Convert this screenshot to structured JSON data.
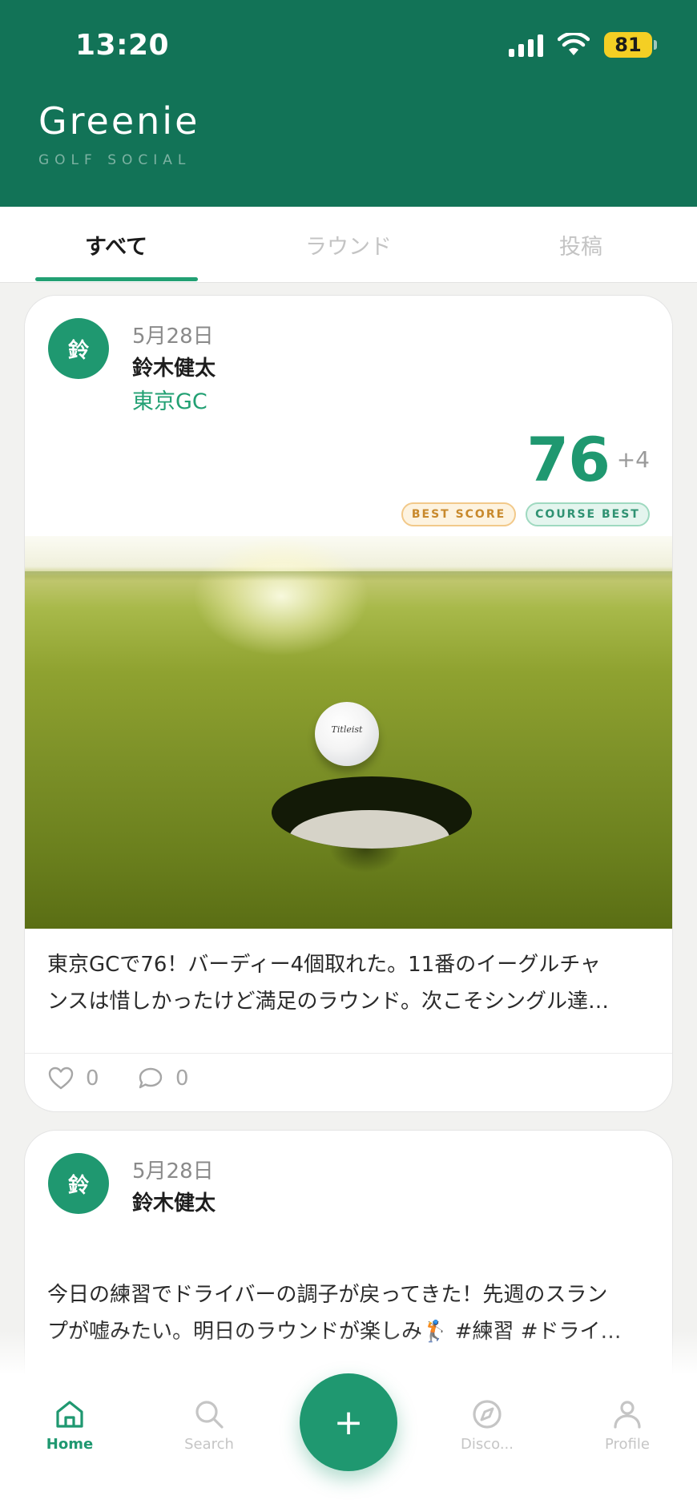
{
  "status_bar": {
    "time": "13:20",
    "battery": "81",
    "icons": [
      "signal-icon",
      "wifi-icon",
      "battery-icon"
    ]
  },
  "header": {
    "title": "Greenie",
    "subtitle": "GOLF SOCIAL"
  },
  "tabs": [
    {
      "label": "すべて",
      "active": true
    },
    {
      "label": "ラウンド",
      "active": false
    },
    {
      "label": "投稿",
      "active": false
    }
  ],
  "feed": [
    {
      "avatar_initial": "鈴",
      "date": "5月28日",
      "author": "鈴木健太",
      "course": "東京GC",
      "score": "76",
      "score_diff": "+4",
      "badges": [
        "BEST SCORE",
        "COURSE BEST"
      ],
      "photo_ball_text": "Titleist",
      "text_lines": [
        "東京GCで76！バーディー4個取れた。11番のイーグルチャ",
        "ンスは惜しかったけど満足のラウンド。次こそシングル達…"
      ],
      "likes": "0",
      "comments": "0"
    },
    {
      "avatar_initial": "鈴",
      "date": "5月28日",
      "author": "鈴木健太",
      "text_lines": [
        "今日の練習でドライバーの調子が戻ってきた！先週のスラン",
        "プが嘘みたい。明日のラウンドが楽しみ🏌 #練習 #ドライ…"
      ]
    }
  ],
  "bottom_nav": {
    "items": [
      {
        "label": "Home",
        "icon": "home-icon",
        "active": true
      },
      {
        "label": "Search",
        "icon": "search-icon",
        "active": false
      },
      {
        "label": "Disco...",
        "icon": "compass-icon",
        "active": false
      },
      {
        "label": "Profile",
        "icon": "profile-icon",
        "active": false
      }
    ],
    "fab_label": "+"
  },
  "colors": {
    "brand": "#127357",
    "accent": "#1f9870",
    "best_score_badge": "#c8892c",
    "course_best_badge": "#2f9272"
  }
}
